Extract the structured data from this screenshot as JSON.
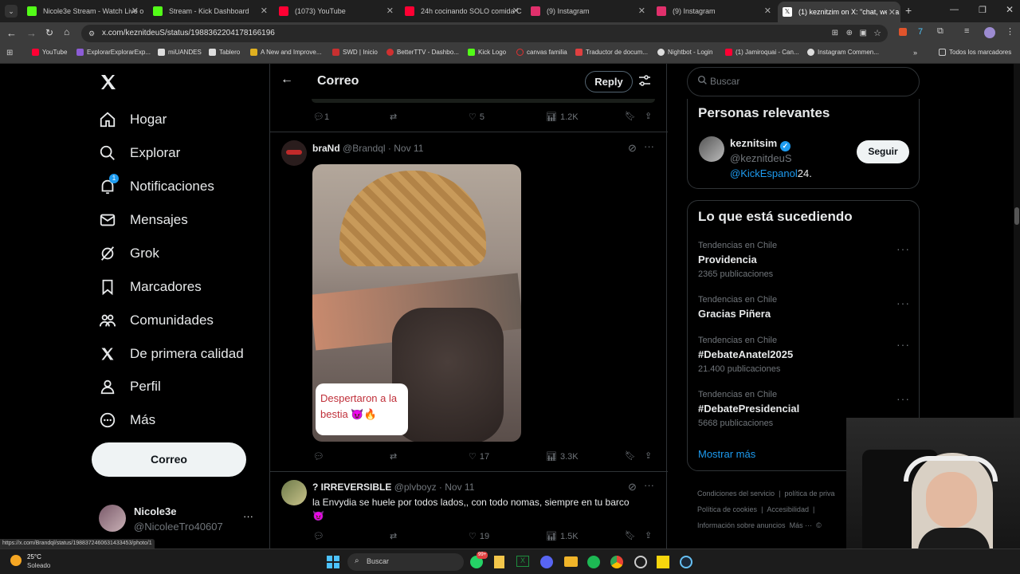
{
  "browser": {
    "tabs": [
      {
        "label": "Nicole3e Stream - Watch Live o",
        "color": "#53fc18"
      },
      {
        "label": "Stream - Kick Dashboard",
        "color": "#53fc18"
      },
      {
        "label": "(1073) YouTube",
        "color": "#ff0033"
      },
      {
        "label": "24h cocinando SOLO comida C",
        "color": "#ff0033"
      },
      {
        "label": "(9) Instagram",
        "color": "#e1306c"
      },
      {
        "label": "(9) Instagram",
        "color": "#e1306c"
      },
      {
        "label": "(1) keznitzim on X: \"chat, we ba",
        "color": "#ffffff"
      }
    ],
    "url": "x.com/keznitdeuS/status/1988362204178166196",
    "bookmarks": [
      "YouTube",
      "ExplorarExplorarExp...",
      "miUANDES",
      "Tablero",
      "A New and Improve...",
      "SWD | Inicio",
      "BetterTTV - Dashbo...",
      "Kick Logo",
      "canvas familia",
      "Traductor de docum...",
      "Nightbot - Login",
      "(1) Jamiroquai - Can...",
      "Instagram Commen..."
    ],
    "bookmarks_folder": "Todos los marcadores",
    "status_url": "https://x.com/Brandql/status/1988372460631433453/photo/1"
  },
  "sidebar": {
    "items": [
      {
        "label": "Hogar",
        "icon": "home-icon"
      },
      {
        "label": "Explorar",
        "icon": "search-icon"
      },
      {
        "label": "Notificaciones",
        "icon": "bell-icon",
        "badge": "1"
      },
      {
        "label": "Mensajes",
        "icon": "mail-icon"
      },
      {
        "label": "Grok",
        "icon": "grok-icon"
      },
      {
        "label": "Marcadores",
        "icon": "bookmark-icon"
      },
      {
        "label": "Comunidades",
        "icon": "communities-icon"
      },
      {
        "label": "De primera calidad",
        "icon": "x-logo-icon"
      },
      {
        "label": "Perfil",
        "icon": "person-icon"
      },
      {
        "label": "Más",
        "icon": "more-circle-icon"
      }
    ],
    "compose": "Correo",
    "account": {
      "name": "Nicole3e",
      "handle": "@NicoleeTro40607"
    }
  },
  "header": {
    "title": "Correo",
    "reply": "Reply"
  },
  "prev_post": {
    "replies": "1",
    "likes": "5",
    "views": "1.2K"
  },
  "post1": {
    "name": "braNd",
    "handle": "@Brandql",
    "date": "· Nov 11",
    "caption": "Despertaron a la bestia 😈🔥",
    "replies": "",
    "likes": "17",
    "views": "3.3K"
  },
  "post2": {
    "name": "? IRREVERSIBLE",
    "handle": "@plvboyz",
    "date": "· Nov 11",
    "text": "la Envydia se huele por todos lados,, con todo nomas, siempre en tu barco",
    "emoji": "😈",
    "likes": "19",
    "views": "1.5K"
  },
  "search": {
    "placeholder": "Buscar"
  },
  "relevant": {
    "title": "Personas relevantes",
    "name": "keznitsim",
    "handle": "@keznitdeuS",
    "bio_link": "@KickEspanol",
    "bio_rest": "24.",
    "follow": "Seguir"
  },
  "trending": {
    "title": "Lo que está sucediendo",
    "items": [
      {
        "context": "Tendencias en Chile",
        "name": "Providencia",
        "count": "2365 publicaciones"
      },
      {
        "context": "Tendencias en Chile",
        "name": "Gracias Piñera",
        "count": ""
      },
      {
        "context": "Tendencias en Chile",
        "name": "#DebateAnatel2025",
        "count": "21.400 publicaciones"
      },
      {
        "context": "Tendencias en Chile",
        "name": "#DebatePresidencial",
        "count": "5668 publicaciones"
      }
    ],
    "show_more": "Mostrar más"
  },
  "footer": {
    "links": [
      "Condiciones del servicio",
      "|",
      "política de priva",
      "Política de cookies",
      "|",
      "Accesibilidad",
      "|",
      "Información sobre anuncios",
      "Más ···",
      "©"
    ]
  },
  "taskbar": {
    "temp": "25°C",
    "weather": "Soleado",
    "search": "Buscar",
    "badge": "99+"
  },
  "colors": {
    "accent": "#1d9bf0",
    "bg": "#000000",
    "border": "#2f3336",
    "muted": "#71767b"
  }
}
